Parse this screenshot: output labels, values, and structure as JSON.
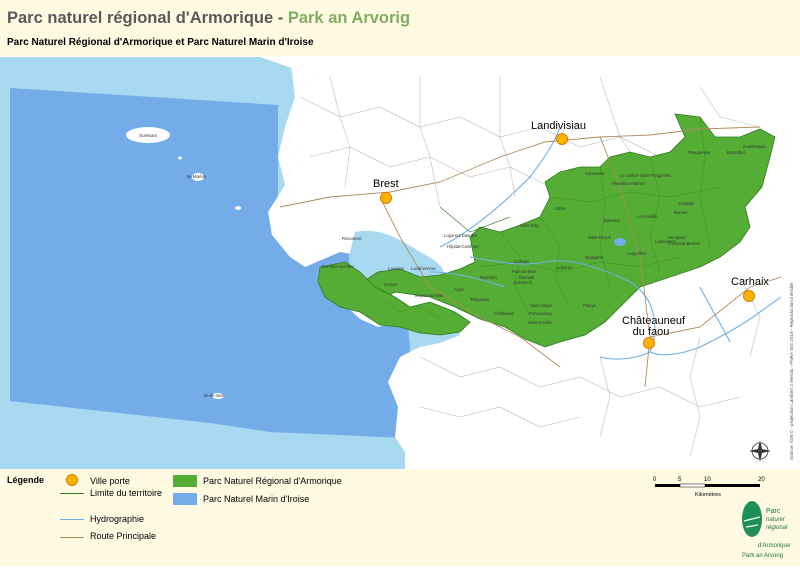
{
  "header": {
    "title_main": "Parc naturel régional d'Armorique - ",
    "title_breton": "Park an Arvorig",
    "subtitle": "Parc Naturel Régional d'Armorique et Parc Naturel Marin d'Iroise"
  },
  "colors": {
    "sea": "#a7d9f0",
    "marine_park": "#74acea",
    "regional_park": "#55ad35",
    "land": "#ffffff",
    "city_marker": "#f9b400",
    "header_bg": "#fffbe3",
    "title_accent": "#7fae63"
  },
  "cities": [
    {
      "name": "Landivisiau"
    },
    {
      "name": "Brest"
    },
    {
      "name": "Carhaix"
    },
    {
      "name": "Châteauneuf du faou"
    }
  ],
  "places": [
    "Ouessant",
    "Ile Molène",
    "Ile-de-Sein",
    "Logonna-Daoulas",
    "Hôpital-Camfrout",
    "Rosnoën",
    "Le Faou",
    "Saint-Eloy",
    "Sizun",
    "Commana",
    "Plouyé",
    "Brasparts",
    "Lopérec",
    "Saint-Rivoal",
    "Botmeur",
    "Huelgoat",
    "Landévennec",
    "Argol",
    "Telgruc-sur-Mer",
    "Crozon",
    "Camaret-sur-Mer",
    "Roscanvel",
    "Lanvéoc",
    "Dinéault",
    "Châteaulin",
    "Saint-Ségal",
    "Port-Launay",
    "Pont-de-Buis",
    "Quimerc'h",
    "Locmaria-Berrien",
    "Berrien",
    "Scrignac",
    "Guerlesquin",
    "Botsorhel",
    "Plougonven",
    "Le Cloître-Saint-Thégonnec",
    "Plounéour-Ménez",
    "La Feuillée",
    "Loqueffret",
    "Lannédern",
    "Trégarvan",
    "Saint-Coulitz"
  ],
  "source_text": "Source: IGN © - projection Lambert 2 étendu - PNRA SIG 2019 - Reproduction interdite",
  "legend": {
    "title": "Légende",
    "items": [
      {
        "label": "Ville porte"
      },
      {
        "label": "Limite du territoire"
      },
      {
        "label": "Hydrographie"
      },
      {
        "label": "Route Principale"
      },
      {
        "label": "Parc Naturel Régional d'Armorique"
      },
      {
        "label": "Parc Naturel Marin d'Iroise"
      }
    ]
  },
  "scale": {
    "ticks": [
      "0",
      "5",
      "10",
      "20"
    ],
    "unit": "Kilomètres"
  },
  "logo": {
    "line1": "Parc",
    "line2": "naturel",
    "line3": "régional",
    "line4": "d'Armorique",
    "line5": "Park an Arvorig"
  }
}
